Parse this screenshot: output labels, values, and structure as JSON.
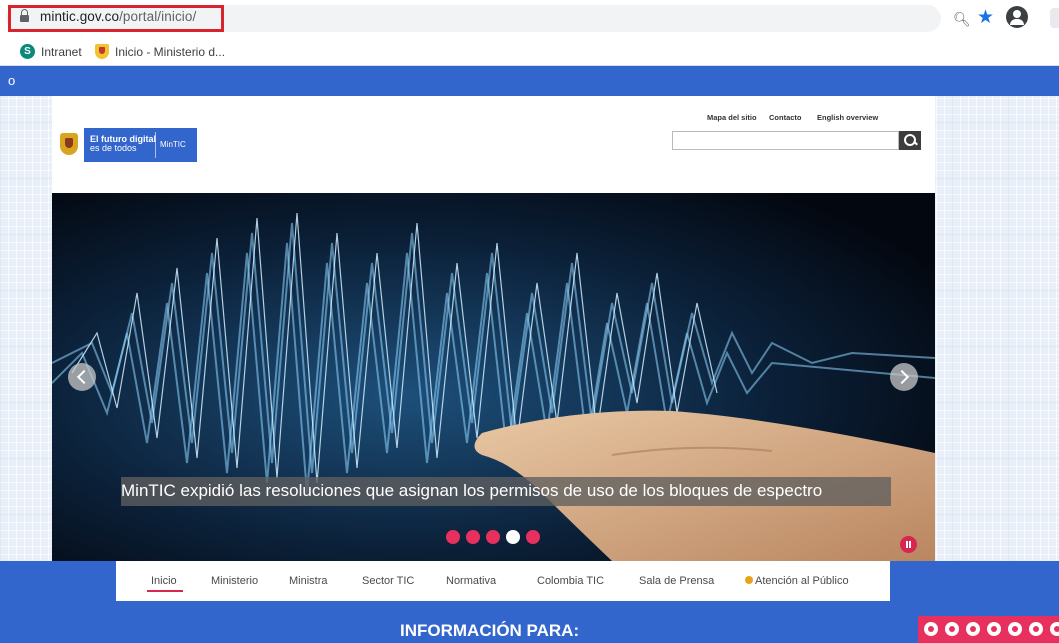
{
  "browser": {
    "url_host": "mintic.gov.co",
    "url_path": "/portal/inicio/",
    "bookmarks": [
      {
        "label": "Intranet",
        "icon": "sharepoint-icon"
      },
      {
        "label": "Inicio - Ministerio d...",
        "icon": "colombia-shield-icon"
      }
    ]
  },
  "header": {
    "partial_text": "o",
    "logo": {
      "line1": "El futuro digital",
      "line2": "es de todos",
      "brand": "MinTIC"
    },
    "links": [
      "Mapa del sitio",
      "Contacto",
      "English overview"
    ],
    "search_placeholder": ""
  },
  "slider": {
    "caption": "MinTIC expidió las resoluciones que asignan los permisos de uso de los bloques de espectro",
    "total_slides": 5,
    "active_slide": 4
  },
  "nav": {
    "items": [
      "Inicio",
      "Ministerio",
      "Ministra",
      "Sector TIC",
      "Normativa",
      "Colombia TIC",
      "Sala de Prensa",
      "Atención al Público"
    ],
    "active": "Inicio"
  },
  "section": {
    "title": "INFORMACIÓN PARA:"
  },
  "colors": {
    "brand_blue": "#3366cc",
    "accent_pink": "#e8305e",
    "highlight_red": "#d9232f"
  }
}
